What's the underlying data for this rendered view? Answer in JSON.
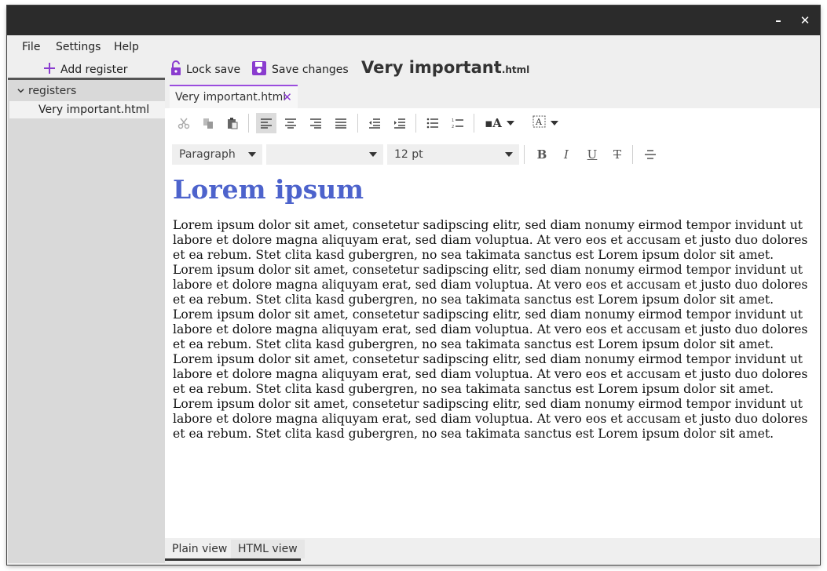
{
  "window": {
    "minimize_label": "–",
    "close_label": "✕"
  },
  "menu": {
    "items": [
      "File",
      "Settings",
      "Help"
    ]
  },
  "toolbar": {
    "add_register": "Add register",
    "lock_save": "Lock save",
    "save_changes": "Save changes",
    "doc_title_name": "Very important",
    "doc_title_ext": ".html"
  },
  "sidebar": {
    "root_label": "registers",
    "items": [
      "Very important.html"
    ]
  },
  "editor_tabs": [
    {
      "label": "Very important.html",
      "active": true
    }
  ],
  "format_bar": {
    "paragraph_style": "Paragraph",
    "font_family": "",
    "font_size": "12 pt"
  },
  "document": {
    "heading": "Lorem ipsum",
    "body": "Lorem ipsum dolor sit amet, consetetur sadipscing elitr, sed diam nonumy eirmod tempor invidunt ut labore et dolore magna aliquyam erat, sed diam voluptua. At vero eos et accusam et justo duo dolores et ea rebum. Stet clita kasd gubergren, no sea takimata sanctus est Lorem ipsum dolor sit amet. Lorem ipsum dolor sit amet, consetetur sadipscing elitr, sed diam nonumy eirmod tempor invidunt ut labore et dolore magna aliquyam erat, sed diam voluptua. At vero eos et accusam et justo duo dolores et ea rebum. Stet clita kasd gubergren, no sea takimata sanctus est Lorem ipsum dolor sit amet. Lorem ipsum dolor sit amet, consetetur sadipscing elitr, sed diam nonumy eirmod tempor invidunt ut labore et dolore magna aliquyam erat, sed diam voluptua. At vero eos et accusam et justo duo dolores et ea rebum. Stet clita kasd gubergren, no sea takimata sanctus est Lorem ipsum dolor sit amet. Lorem ipsum dolor sit amet, consetetur sadipscing elitr, sed diam nonumy eirmod tempor invidunt ut labore et dolore magna aliquyam erat, sed diam voluptua. At vero eos et accusam et justo duo dolores et ea rebum. Stet clita kasd gubergren, no sea takimata sanctus est Lorem ipsum dolor sit amet. Lorem ipsum dolor sit amet, consetetur sadipscing elitr, sed diam nonumy eirmod tempor invidunt ut labore et dolore magna aliquyam erat, sed diam voluptua. At vero eos et accusam et justo duo dolores et ea rebum. Stet clita kasd gubergren, no sea takimata sanctus est Lorem ipsum dolor sit amet."
  },
  "view_tabs": [
    "Plain view",
    "HTML view"
  ],
  "colors": {
    "accent": "#9b4dde",
    "heading": "#4d63cc",
    "titlebar": "#2b2b2b"
  }
}
